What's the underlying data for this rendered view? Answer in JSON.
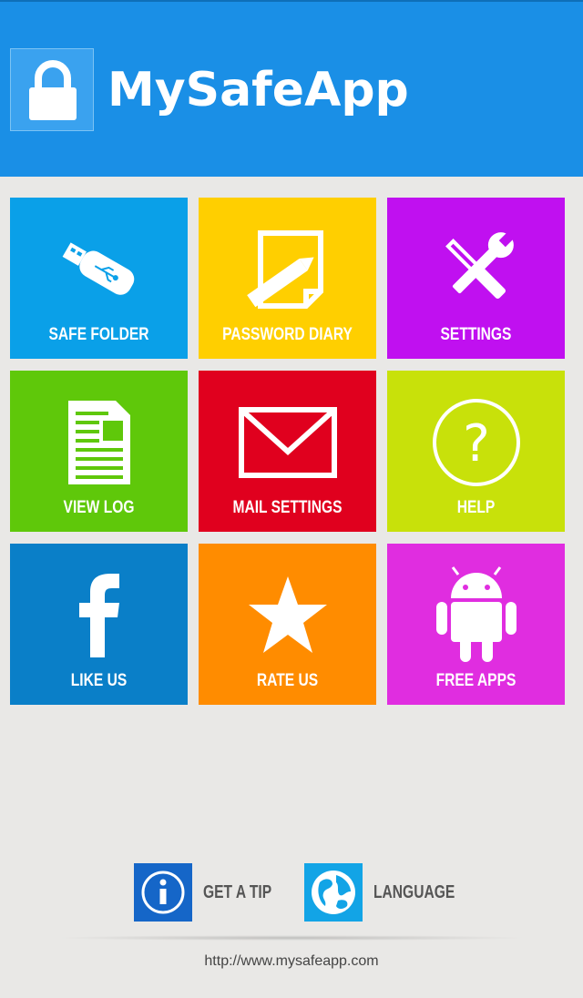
{
  "app": {
    "title": "MySafeApp",
    "url": "http://www.mysafeapp.com"
  },
  "colors": {
    "header": "#1a8fe6",
    "background": "#e9e8e6"
  },
  "tiles": [
    {
      "label": "SAFE FOLDER",
      "icon": "usb-drive-icon",
      "color": "#0aa0e8"
    },
    {
      "label": "PASSWORD DIARY",
      "icon": "note-pencil-icon",
      "color": "#ffcf00"
    },
    {
      "label": "SETTINGS",
      "icon": "tools-icon",
      "color": "#c010f0"
    },
    {
      "label": "VIEW LOG",
      "icon": "document-icon",
      "color": "#5fc80a"
    },
    {
      "label": "MAIL SETTINGS",
      "icon": "envelope-icon",
      "color": "#e0001e"
    },
    {
      "label": "HELP",
      "icon": "question-icon",
      "color": "#c8e10a"
    },
    {
      "label": "LIKE US",
      "icon": "facebook-icon",
      "color": "#0a7fc8"
    },
    {
      "label": "RATE US",
      "icon": "star-icon",
      "color": "#ff8c00"
    },
    {
      "label": "FREE APPS",
      "icon": "android-icon",
      "color": "#e02de0"
    }
  ],
  "bottom": {
    "tip_label": "GET A TIP",
    "language_label": "LANGUAGE"
  }
}
